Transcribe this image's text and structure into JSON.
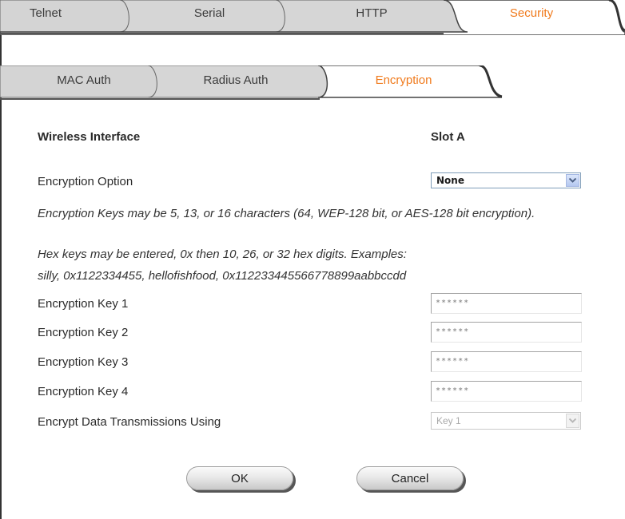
{
  "tabs": {
    "top": [
      {
        "label": "Telnet",
        "active": false
      },
      {
        "label": "Serial",
        "active": false
      },
      {
        "label": "HTTP",
        "active": false
      },
      {
        "label": "Security",
        "active": true
      }
    ],
    "sub": [
      {
        "label": "MAC Auth",
        "active": false
      },
      {
        "label": "Radius Auth",
        "active": false
      },
      {
        "label": "Encryption",
        "active": true
      }
    ]
  },
  "form": {
    "header_label": "Wireless Interface",
    "header_value": "Slot A",
    "encryption_option_label": "Encryption Option",
    "encryption_option_value": "None",
    "note_1": "Encryption Keys may be 5, 13, or 16 characters (64, WEP-128 bit, or AES-128 bit encryption).",
    "note_2": "Hex keys may be entered, 0x then 10, 26, or 32 hex digits. Examples:",
    "note_3": "silly, 0x1122334455, hellofishfood, 0x112233445566778899aabbccdd",
    "keys": [
      {
        "label": "Encryption Key 1",
        "value": "******"
      },
      {
        "label": "Encryption Key 2",
        "value": "******"
      },
      {
        "label": "Encryption Key 3",
        "value": "******"
      },
      {
        "label": "Encryption Key 4",
        "value": "******"
      }
    ],
    "transmit_label": "Encrypt Data Transmissions Using",
    "transmit_value": "Key 1"
  },
  "buttons": {
    "ok": "OK",
    "cancel": "Cancel"
  },
  "colors": {
    "active_tab": "#f07a1c",
    "tab_bg": "#d4d4d4"
  }
}
